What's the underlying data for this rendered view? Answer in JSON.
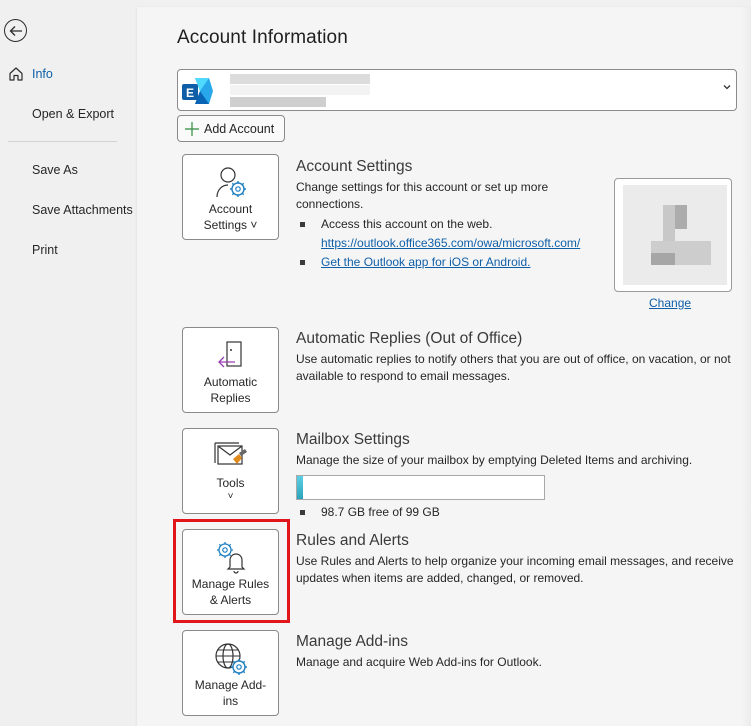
{
  "sidebar": {
    "back_label": "Back",
    "items": [
      {
        "label": "Info",
        "active": true,
        "icon": "home-icon"
      },
      {
        "label": "Open & Export"
      },
      {
        "label": "Save As"
      },
      {
        "label": "Save Attachments"
      },
      {
        "label": "Print"
      }
    ]
  },
  "main": {
    "title": "Account Information",
    "account_selector": {
      "icon": "exchange-icon",
      "value": "",
      "chevron": "chevron-down-icon"
    },
    "add_account_label": "Add Account",
    "sections": [
      {
        "tile_label": "Account Settings ˅",
        "tile_icon": "person-gear-icon",
        "title": "Account Settings",
        "description": "Change settings for this account or set up more connections.",
        "bullets": [
          {
            "text": "Access this account on the web.",
            "link": "https://outlook.office365.com/owa/microsoft.com/"
          },
          {
            "link": "Get the Outlook app for iOS or Android."
          }
        ]
      },
      {
        "tile_label": "Automatic Replies",
        "tile_icon": "door-arrow-icon",
        "title": "Automatic Replies (Out of Office)",
        "description": "Use automatic replies to notify others that you are out of office, on vacation, or not available to respond to email messages."
      },
      {
        "tile_label": "Tools",
        "tile_chevron": "˅",
        "tile_icon": "mailbox-broom-icon",
        "title": "Mailbox Settings",
        "description": "Manage the size of your mailbox by emptying Deleted Items and archiving.",
        "quota_used_fraction": 0.013,
        "quota_text": "98.7 GB free of 99 GB"
      },
      {
        "tile_label": "Manage Rules & Alerts",
        "tile_icon": "gear-bell-icon",
        "title": "Rules and Alerts",
        "description": "Use Rules and Alerts to help organize your incoming email messages, and receive updates when items are added, changed, or removed.",
        "highlighted": true
      },
      {
        "tile_label": "Manage Add-ins",
        "tile_icon": "globe-gear-icon",
        "title": "Manage Add-ins",
        "description": "Manage and acquire Web Add-ins for Outlook."
      }
    ],
    "profile_photo": {
      "change_label": "Change"
    }
  },
  "colors": {
    "accent": "#0f5fa8",
    "highlight": "#e0161a",
    "quota_fill": "#2aa3b8",
    "icon_blue": "#1f7fc1",
    "icon_purple": "#9b3fb5",
    "icon_orange": "#e08a1e"
  }
}
